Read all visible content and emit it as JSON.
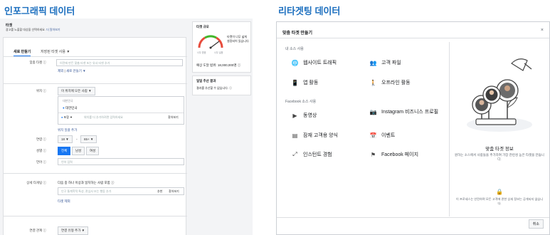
{
  "left_heading": "인포그래픽 데이터",
  "right_heading": "리타겟팅 데이터",
  "left": {
    "tab_title": "타겟",
    "tab_desc": "광고를 노출할 대상을 선택하세요.",
    "tab_desc_link": "더 알아보기",
    "tabs": [
      "새로 만들기",
      "저장된 타겟 사용 ▼"
    ],
    "custom_label": "맞춤 타겟 ⓘ",
    "custom_placeholder": "이전에 만든 맞춤 타겟 또는 유사 타겟 추가",
    "exclude": "제외",
    "create_new": "새로 만들기 ▼",
    "location_label": "위치 ⓘ",
    "location_select": "이 위치에 모든 사람 ▼",
    "korea_header": "대한민국",
    "korea_item": "대한민국",
    "include_select": "포함 ▼",
    "location_placeholder": "위치를 더 추가하려면 입력하세요",
    "browse": "찾아보기",
    "bulk_add": "위치 일괄 추가",
    "age_label": "연령 ⓘ",
    "age_min": "18 ▼",
    "age_dash": "-",
    "age_max": "65+ ▼",
    "gender_label": "성별 ⓘ",
    "genders": [
      "전체",
      "남성",
      "여성"
    ],
    "lang_label": "언어 ⓘ",
    "lang_placeholder": "언어 입력",
    "detail_label": "상세 타게팅 ⓘ",
    "detail_desc": "다음 중 하나 이상과 일치하는 사람 포함 ⓘ",
    "detail_placeholder": "인구 통계학적 특성, 관심사 또는 행동 추가",
    "suggest": "추천",
    "browse2": "찾아보기",
    "exclude_people": "타겟 제외",
    "connection_label": "연결 관계 ⓘ",
    "connection_select": "연결 유형 추가 ▼",
    "size_title": "타겟 규모",
    "size_desc": "타켓이 너무 넓게 설정되어 있습니다.",
    "gauge_left": "너무 좁음",
    "gauge_right": "너무 넓음",
    "reach": "예상 도달 범위: 18,000,000명 ⓘ",
    "daily_title": "일일 추산 결과",
    "daily_desc": "결과를 추산할 수 없습니다. ⓘ"
  },
  "modal": {
    "title": "맞춤 타겟 만들기",
    "close": "×",
    "own_sources": "내 소스 사용",
    "own": [
      {
        "icon": "globe-icon",
        "glyph": "🌐",
        "label": "웹사이트 트래픽"
      },
      {
        "icon": "people-icon",
        "glyph": "👥",
        "label": "고객 파일"
      },
      {
        "icon": "mobile-icon",
        "glyph": "📱",
        "label": "앱 활동"
      },
      {
        "icon": "person-walk-icon",
        "glyph": "🚶",
        "label": "오프라인 활동"
      }
    ],
    "fb_sources": "Facebook 소스 사용",
    "fb": [
      {
        "icon": "play-icon",
        "glyph": "▶",
        "label": "동영상"
      },
      {
        "icon": "instagram-icon",
        "glyph": "📷",
        "label": "Instagram 비즈니스 프로필"
      },
      {
        "icon": "form-icon",
        "glyph": "▤",
        "label": "잠재 고객용 양식"
      },
      {
        "icon": "calendar-icon",
        "glyph": "📅",
        "label": "이벤트"
      },
      {
        "icon": "expand-icon",
        "glyph": "⤢",
        "label": "인스턴트 경험"
      },
      {
        "icon": "flag-icon",
        "glyph": "⚑",
        "label": "Facebook 페이지"
      }
    ],
    "info_title": "맞춤 타겟 정보",
    "info_desc": "원하는 소스에서 사람들을 추가하여 가장 관련성 높은 타겟을 만듭니다.",
    "privacy": "이 프로세스는 안전하며 모든 고객에 관한 상세 정보는 공개되지 않습니다.",
    "cancel": "취소"
  }
}
